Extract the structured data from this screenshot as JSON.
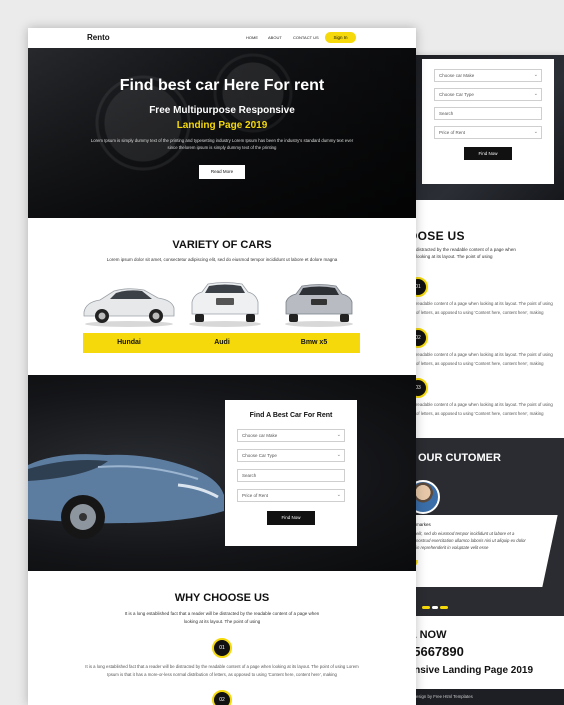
{
  "colors": {
    "accent": "#f5d90a",
    "dark": "#111111"
  },
  "nav": {
    "logo": "Rento",
    "links": [
      "HOME",
      "ABOUT",
      "CONTACT US"
    ],
    "signin": "Sign In"
  },
  "hero": {
    "title": "Find best car Here For rent",
    "subtitle": "Free Multipurpose Responsive",
    "subtitle2": "Landing Page 2019",
    "text": "Lorem Ipsum is simply dummy text of the printing and typesetting industry Lorem Ipsum has been the industry's standard dummy text ever since thelorem ipsum is simply dummy text of the printing",
    "button": "Read More"
  },
  "variety": {
    "title": "VARIETY OF CARS",
    "text": "Lorem ipsum dolor sit amet, consectetur adipiscing elit, sed do eiusmod tempor incididunt ut labore et dolore magna",
    "cars": [
      "Hundai",
      "Audi",
      "Bmw x5"
    ]
  },
  "find": {
    "title": "Find A Best Car For Rent",
    "make": "Choose car Make",
    "type": "Choose Car Type",
    "search": "Search",
    "price": "Price of Rent",
    "button": "Find Now"
  },
  "why": {
    "title": "WHY CHOOSE US",
    "text": "It is a long established fact that a reader will be distracted by the readable content of a page when looking at its layout. The point of using",
    "items": [
      {
        "num": "01",
        "text": "It is a long established fact that a reader will be distracted by the readable content of a page when looking at its layout. The point of using Lorem Ipsum is that it has a more-or-less normal distribution of letters, as opposed to using 'Content here, content here', making"
      },
      {
        "num": "02"
      }
    ]
  },
  "right": {
    "make": "Choose car Make",
    "type": "Choose Car Type",
    "search": "Search",
    "price": "Price of Rent",
    "button": "Find Now",
    "why_title": "OOSE US",
    "why_text": "distracted by the readable content of a page when looking at its layout. The point of using",
    "items": [
      {
        "num": "01",
        "line1": "readable content of a page when looking at its layout. The point of using",
        "line2": "of letters, as opposed to using 'Content here, content here', making"
      },
      {
        "num": "02",
        "line1": "readable content of a page when looking at its layout. The point of using",
        "line2": "of letters, as opposed to using 'Content here, content here', making"
      },
      {
        "num": "03",
        "line1": "readable content of a page when looking at its layout. The point of using",
        "line2": "of letters, as opposed to using 'Content here, content here', making"
      }
    ],
    "testimonial_title": "OUR CUTOMER",
    "customer_name": "markes",
    "quote": "elit, sed do eiusmod tempor incididunt ut labore et a nostrud exercitation ullamco laboris nisi ut aliquip ex dolor in reprehenderit in voluptate velit esse",
    "call_title": "L NOW",
    "phone": "45667890",
    "landing": "onsive Landing Page 2019",
    "footer": "esign by Free Html Templates"
  }
}
